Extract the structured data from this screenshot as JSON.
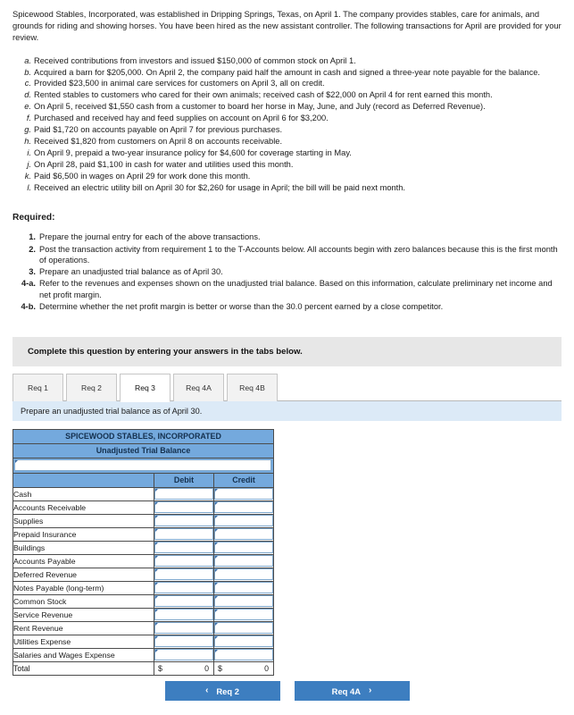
{
  "intro": "Spicewood Stables, Incorporated, was established in Dripping Springs, Texas, on April 1. The company provides stables, care for animals, and grounds for riding and showing horses. You have been hired as the new assistant controller. The following transactions for April are provided for your review.",
  "transactions": [
    {
      "letter": "a.",
      "text": "Received contributions from investors and issued $150,000 of common stock on April 1."
    },
    {
      "letter": "b.",
      "text": "Acquired a barn for $205,000. On April 2, the company paid half the amount in cash and signed a three-year note payable for the balance."
    },
    {
      "letter": "c.",
      "text": "Provided $23,500 in animal care services for customers on April 3, all on credit."
    },
    {
      "letter": "d.",
      "text": "Rented stables to customers who cared for their own animals; received cash of $22,000 on April 4 for rent earned this month."
    },
    {
      "letter": "e.",
      "text": "On April 5, received $1,550 cash from a customer to board her horse in May, June, and July (record as Deferred Revenue)."
    },
    {
      "letter": "f.",
      "text": "Purchased and received hay and feed supplies on account on April 6 for $3,200."
    },
    {
      "letter": "g.",
      "text": "Paid $1,720 on accounts payable on April 7 for previous purchases."
    },
    {
      "letter": "h.",
      "text": "Received $1,820 from customers on April 8 on accounts receivable."
    },
    {
      "letter": "i.",
      "text": "On April 9, prepaid a two-year insurance policy for $4,600 for coverage starting in May."
    },
    {
      "letter": "j.",
      "text": "On April 28, paid $1,100 in cash for water and utilities used this month."
    },
    {
      "letter": "k.",
      "text": "Paid $6,500 in wages on April 29 for work done this month."
    },
    {
      "letter": "l.",
      "text": "Received an electric utility bill on April 30 for $2,260 for usage in April; the bill will be paid next month."
    }
  ],
  "required": {
    "title": "Required:",
    "items": [
      {
        "num": "1.",
        "text": "Prepare the journal entry for each of the above transactions."
      },
      {
        "num": "2.",
        "text": "Post the transaction activity from requirement 1 to the T-Accounts below. All accounts begin with zero balances because this is the first month of operations."
      },
      {
        "num": "3.",
        "text": "Prepare an unadjusted trial balance as of April 30."
      },
      {
        "num": "4-a.",
        "text": "Refer to the revenues and expenses shown on the unadjusted trial balance. Based on this information, calculate preliminary net income and net profit margin."
      },
      {
        "num": "4-b.",
        "text": "Determine whether the net profit margin is better or worse than the 30.0 percent earned by a close competitor."
      }
    ]
  },
  "complete_banner": "Complete this question by entering your answers in the tabs below.",
  "tabs": [
    {
      "label": "Req 1",
      "active": false
    },
    {
      "label": "Req 2",
      "active": false
    },
    {
      "label": "Req 3",
      "active": true
    },
    {
      "label": "Req 4A",
      "active": false
    },
    {
      "label": "Req 4B",
      "active": false
    }
  ],
  "sub_banner": "Prepare an unadjusted trial balance as of April 30.",
  "trial_balance": {
    "company": "SPICEWOOD STABLES, INCORPORATED",
    "statement": "Unadjusted Trial Balance",
    "date_value": "",
    "columns": {
      "account": "",
      "debit": "Debit",
      "credit": "Credit"
    },
    "rows": [
      {
        "account": "Cash",
        "debit": "",
        "credit": ""
      },
      {
        "account": "Accounts Receivable",
        "debit": "",
        "credit": ""
      },
      {
        "account": "Supplies",
        "debit": "",
        "credit": ""
      },
      {
        "account": "Prepaid Insurance",
        "debit": "",
        "credit": ""
      },
      {
        "account": "Buildings",
        "debit": "",
        "credit": ""
      },
      {
        "account": "Accounts Payable",
        "debit": "",
        "credit": ""
      },
      {
        "account": "Deferred Revenue",
        "debit": "",
        "credit": ""
      },
      {
        "account": "Notes Payable (long-term)",
        "debit": "",
        "credit": ""
      },
      {
        "account": "Common Stock",
        "debit": "",
        "credit": ""
      },
      {
        "account": "Service Revenue",
        "debit": "",
        "credit": ""
      },
      {
        "account": "Rent Revenue",
        "debit": "",
        "credit": ""
      },
      {
        "account": "Utilities Expense",
        "debit": "",
        "credit": ""
      },
      {
        "account": "Salaries and Wages Expense",
        "debit": "",
        "credit": ""
      }
    ],
    "total": {
      "label": "Total",
      "debit_symbol": "$",
      "debit_value": "0",
      "credit_symbol": "$",
      "credit_value": "0"
    }
  },
  "nav": {
    "prev_label": "Req 2",
    "prev_icon": "chevron-left",
    "next_label": "Req 4A",
    "next_icon": "chevron-right"
  },
  "colors": {
    "table_header_blue": "#74a9dd",
    "sub_banner_blue": "#dceaf7",
    "complete_banner_gray": "#e7e7e7",
    "button_blue": "#3d7ec0",
    "input_border_blue": "#7fa8cd"
  }
}
